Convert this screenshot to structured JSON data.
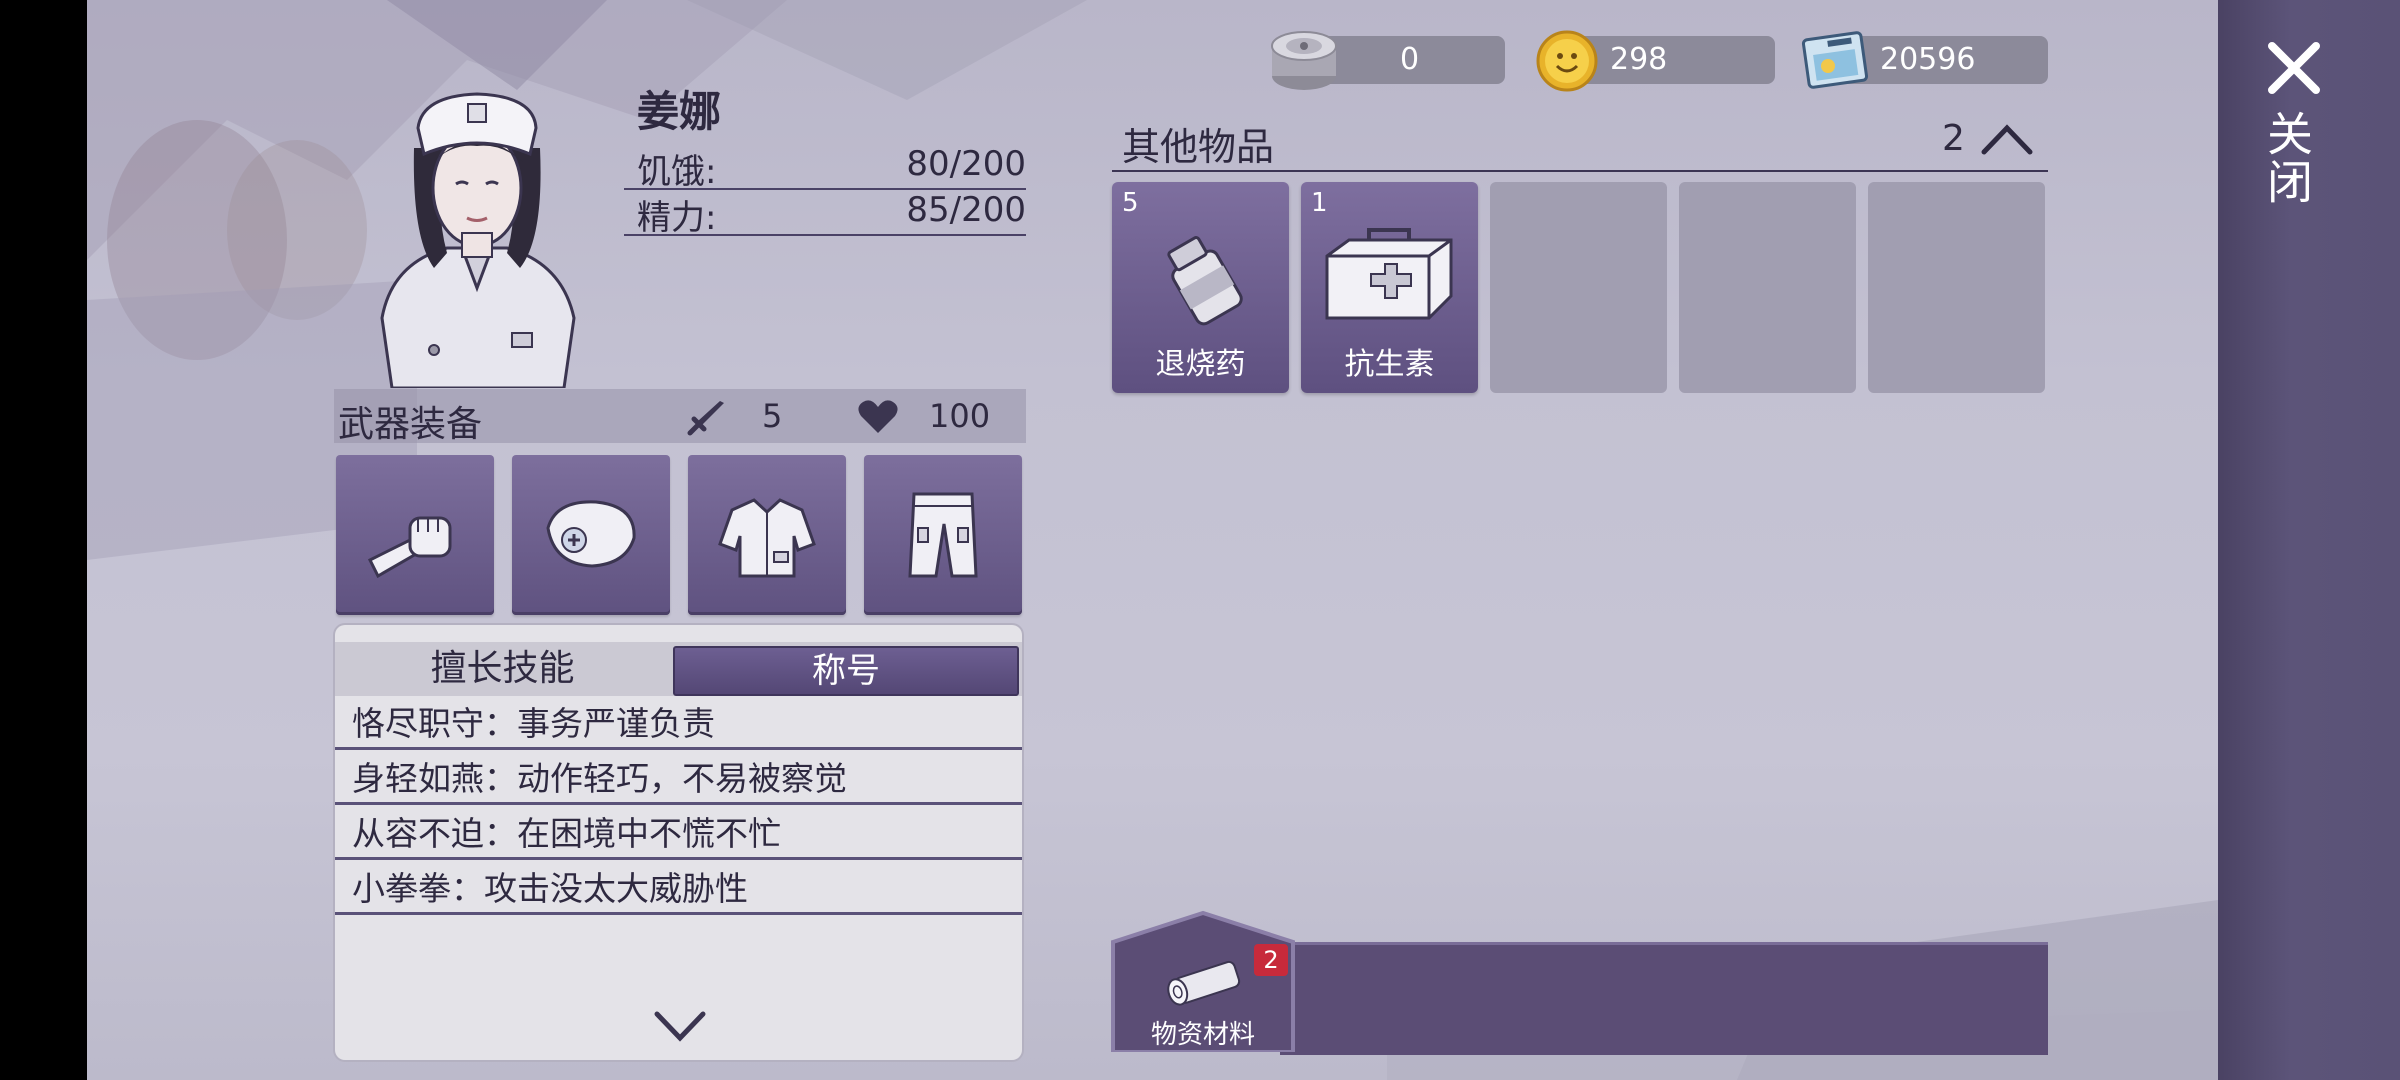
{
  "currencies": [
    {
      "icon": "film-reel-icon",
      "value": "0"
    },
    {
      "icon": "smiley-coin-icon",
      "value": "298"
    },
    {
      "icon": "ticket-icon",
      "value": "20596"
    }
  ],
  "close": {
    "label": "关闭",
    "icon": "close-icon"
  },
  "character": {
    "name": "姜娜",
    "stats": [
      {
        "label": "饥饿:",
        "value": "80/200"
      },
      {
        "label": "精力:",
        "value": "85/200"
      }
    ]
  },
  "weapons": {
    "title": "武器装备",
    "attack": "5",
    "health": "100",
    "slots": [
      {
        "icon": "fist-icon"
      },
      {
        "icon": "nurse-cap-icon"
      },
      {
        "icon": "nurse-shirt-icon"
      },
      {
        "icon": "pants-icon"
      }
    ]
  },
  "skills": {
    "tabs": [
      "擅长技能",
      "称号"
    ],
    "active_tab": "称号",
    "traits": [
      "恪尽职守：事务严谨负责",
      "身轻如燕：动作轻巧，不易被察觉",
      "从容不迫：在困境中不慌不忙",
      "小拳拳：攻击没太大威胁性"
    ]
  },
  "other_items": {
    "title": "其他物品",
    "count": "2",
    "items": [
      {
        "count": "5",
        "name": "退烧药",
        "icon": "medicine-bottle-icon"
      },
      {
        "count": "1",
        "name": "抗生素",
        "icon": "first-aid-kit-icon"
      }
    ],
    "empty_slots": 3
  },
  "category_tab": {
    "label": "物资材料",
    "badge": "2",
    "icon": "wood-log-icon"
  },
  "colors": {
    "panel_purple": "#5b4d75",
    "slot_purple": "#7e6f9f",
    "badge_red": "#c72a3b"
  }
}
